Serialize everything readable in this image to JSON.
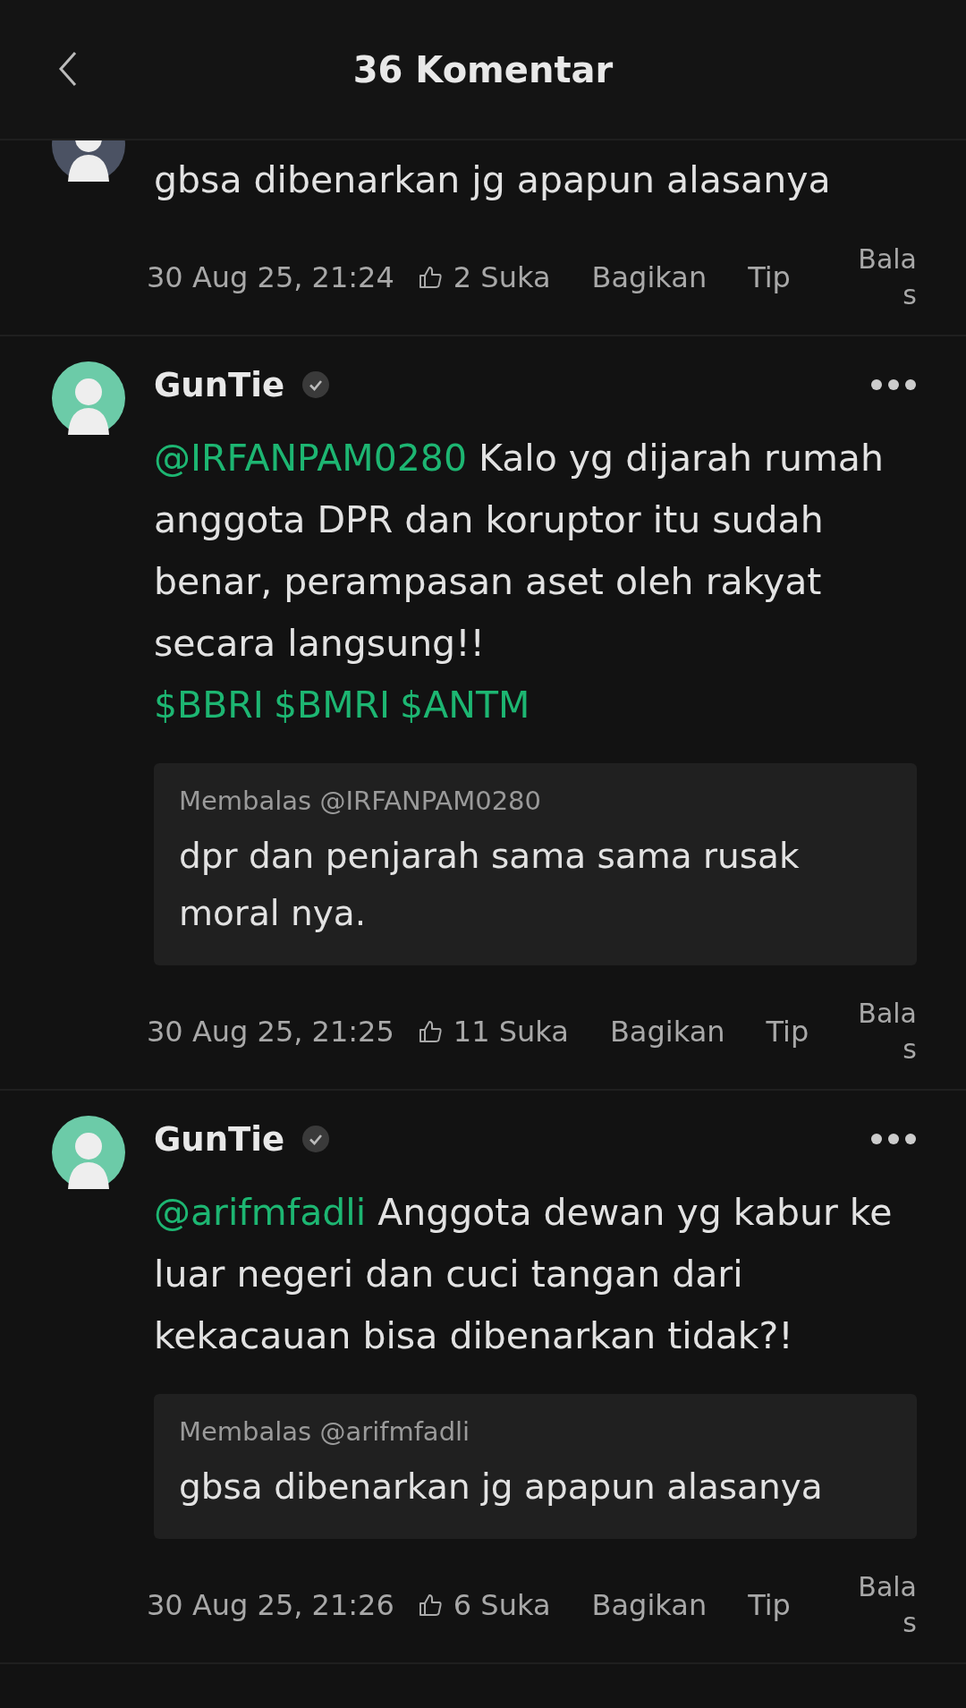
{
  "header": {
    "title": "36 Komentar"
  },
  "comments": [
    {
      "partial": true,
      "color": "#4b5263",
      "body": [
        {
          "kind": "text",
          "text": "gbsa dibenarkan jg apapun alasanya"
        }
      ],
      "time": "30 Aug 25, 21:24",
      "likes": "2 Suka",
      "share": "Bagikan",
      "tip": "Tip",
      "reply": "Balas"
    },
    {
      "partial": false,
      "color": "#6ccba8",
      "user": "GunTie",
      "verified": true,
      "body": [
        {
          "kind": "mention",
          "text": "@IRFANPAM0280"
        },
        {
          "kind": "text",
          "text": " Kalo yg dijarah rumah anggota DPR dan koruptor itu sudah benar, perampasan aset oleh rakyat secara langsung!!"
        }
      ],
      "tickers": [
        "$BBRI",
        "$BMRI",
        "$ANTM"
      ],
      "quote": {
        "label": "Membalas @IRFANPAM0280",
        "text": "dpr dan penjarah sama sama rusak moral nya."
      },
      "time": "30 Aug 25, 21:25",
      "likes": "11 Suka",
      "share": "Bagikan",
      "tip": "Tip",
      "reply": "Balas"
    },
    {
      "partial": false,
      "color": "#6ccba8",
      "user": "GunTie",
      "verified": true,
      "body": [
        {
          "kind": "mention",
          "text": "@arifmfadli"
        },
        {
          "kind": "text",
          "text": " Anggota dewan yg kabur ke luar negeri dan cuci tangan dari kekacauan bisa dibenarkan tidak?!"
        }
      ],
      "quote": {
        "label": "Membalas @arifmfadli",
        "text": "gbsa dibenarkan jg apapun alasanya"
      },
      "time": "30 Aug 25, 21:26",
      "likes": "6 Suka",
      "share": "Bagikan",
      "tip": "Tip",
      "reply": "Balas"
    }
  ]
}
